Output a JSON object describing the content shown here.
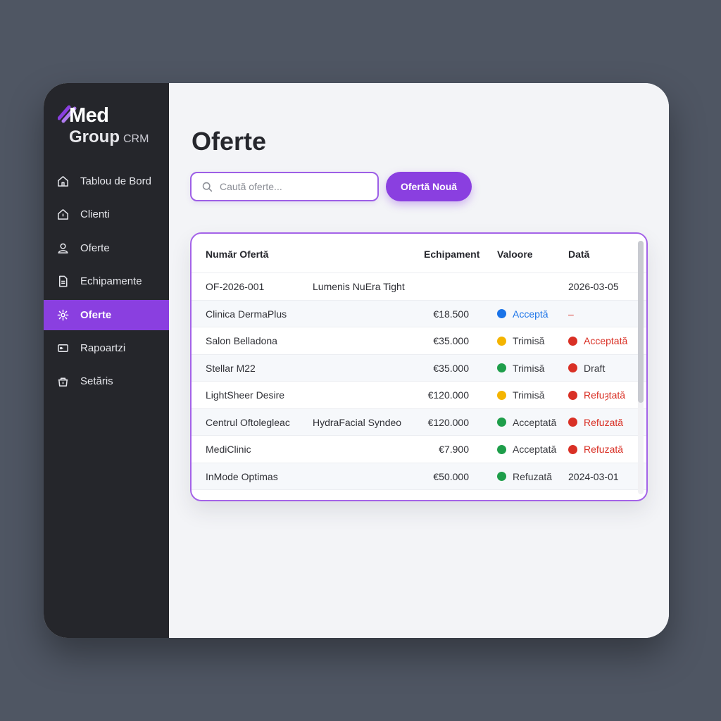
{
  "brand": {
    "name_top": "Med",
    "name_bottom": "Group",
    "suffix": "CRM",
    "accent": "#8a3fe0"
  },
  "sidebar": {
    "items": [
      {
        "label": "Tablou de Bord",
        "icon": "home-icon",
        "active": false
      },
      {
        "label": "Clienti",
        "icon": "building-icon",
        "active": false
      },
      {
        "label": "Oferte",
        "icon": "user-icon",
        "active": false
      },
      {
        "label": "Echipamente",
        "icon": "document-icon",
        "active": false
      },
      {
        "label": "Oferte",
        "icon": "sparkle-icon",
        "active": true
      },
      {
        "label": "Rapoartzi",
        "icon": "report-icon",
        "active": false
      },
      {
        "label": "Setăris",
        "icon": "settings-icon",
        "active": false
      }
    ]
  },
  "main": {
    "title": "Oferte",
    "search": {
      "placeholder": "Caută oferte...",
      "icon": "search-icon"
    },
    "new_button": "Ofertă Nouă"
  },
  "table": {
    "headers": [
      "Număr Ofertă",
      "Echipament",
      "Valoore",
      "Dată"
    ],
    "rows": [
      {
        "c1": "OF-2026-001",
        "c2": "Lumenis NuEra Tight",
        "c3": "",
        "c4": "",
        "c4_color": "",
        "c4_text_color": "",
        "c5": "2026-03-05",
        "c5_color": "",
        "c5_text_color": "#2f3036"
      },
      {
        "c1": "Clinica DermaPlus",
        "c2": "",
        "c3": "€18.500",
        "c4": "Acceptă",
        "c4_color": "#1a73e8",
        "c4_text_color": "#1a73e8",
        "c5": "–",
        "c5_color": "",
        "c5_text_color": "#d93025"
      },
      {
        "c1": "Salon Belladona",
        "c2": "",
        "c3": "€35.000",
        "c4": "Trimisă",
        "c4_color": "#f4b400",
        "c4_text_color": "#3a3b40",
        "c5": "Acceptată",
        "c5_color": "#d93025",
        "c5_text_color": "#d93025"
      },
      {
        "c1": "Stellar M22",
        "c2": "",
        "c3": "€35.000",
        "c4": "Trimisă",
        "c4_color": "#1e9e4a",
        "c4_text_color": "#3a3b40",
        "c5": "Draft",
        "c5_color": "#d93025",
        "c5_text_color": "#3a3b40"
      },
      {
        "c1": "LightSheer Desire",
        "c2": "",
        "c3": "€120.000",
        "c4": "Trimisă",
        "c4_color": "#f4b400",
        "c4_text_color": "#3a3b40",
        "c5": "Refuȝtată",
        "c5_color": "#d93025",
        "c5_text_color": "#d93025"
      },
      {
        "c1": "Centrul Oftolegleac",
        "c2": "HydraFacial Syndeo",
        "c3": "€120.000",
        "c4": "Acceptată",
        "c4_color": "#1e9e4a",
        "c4_text_color": "#3a3b40",
        "c5": "Refuzată",
        "c5_color": "#d93025",
        "c5_text_color": "#d93025"
      },
      {
        "c1": "MediClinic",
        "c2": "",
        "c3": "€7.900",
        "c4": "Acceptată",
        "c4_color": "#1e9e4a",
        "c4_text_color": "#3a3b40",
        "c5": "Refuzată",
        "c5_color": "#d93025",
        "c5_text_color": "#d93025"
      },
      {
        "c1": "InMode Optimas",
        "c2": "",
        "c3": "€50.000",
        "c4": "Refuzată",
        "c4_color": "#1e9e4a",
        "c4_text_color": "#3a3b40",
        "c5": "2024-03-01",
        "c5_color": "",
        "c5_text_color": "#2f3036"
      }
    ]
  }
}
